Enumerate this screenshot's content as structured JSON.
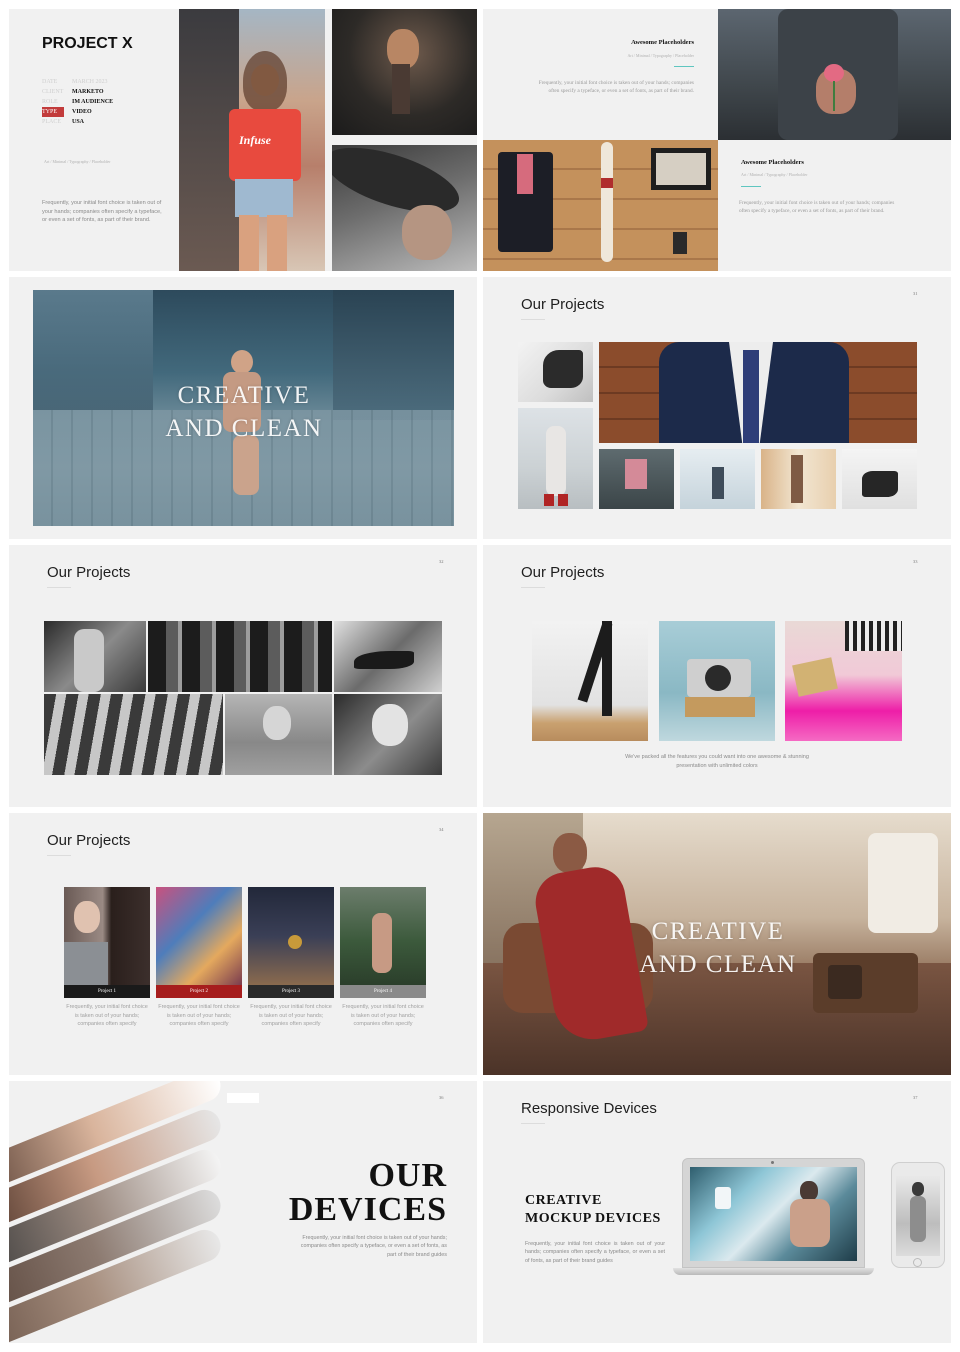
{
  "slide1": {
    "title": "PROJECT X",
    "meta": [
      {
        "key": "DATE",
        "value": "MARCH 2023"
      },
      {
        "key": "CLIENT",
        "value": "MARKETO"
      },
      {
        "key": "ROLE",
        "value": "IM AUDIENCE"
      },
      {
        "key": "TYPE",
        "value": "VIDEO"
      },
      {
        "key": "PLACE",
        "value": "USA"
      }
    ],
    "tags": "Art  /  Minimal  /  Typography  /  Placeholder",
    "body": "Frequently, your initial font choice is taken out of your hands; companies often specify a typeface, or even a set of fonts, as part of their brand.",
    "shirt_text": "Infuse"
  },
  "slide2": {
    "heading_top": "Awesome Placeholders",
    "tags_top": "Art  /  Minimal  /  Typography  /  Placeholder",
    "body_top": "Frequently, your initial font choice is taken out of your hands; companies often specify a typeface, or even a set of fonts, as part of their brand.",
    "heading_bottom": "Awesome Placeholders",
    "tags_bottom": "Art  /  Minimal  /  Typography  /  Placeholder",
    "body_bottom": "Frequently, your initial font choice is taken out of your hands; companies often specify a typeface, or even a set of fonts, as part of their brand."
  },
  "slide3": {
    "line1": "CREATIVE",
    "line2": "AND CLEAN"
  },
  "slide4": {
    "title": "Our Projects",
    "page": "31"
  },
  "slide5": {
    "title": "Our Projects",
    "page": "32"
  },
  "slide6": {
    "title": "Our Projects",
    "page": "33",
    "caption_line1": "We've packed all the features you could want into one awesome & stunning",
    "caption_line2": "presentation with unlimited colors"
  },
  "slide7": {
    "title": "Our Projects",
    "page": "34",
    "projects": [
      {
        "label": "Project 1",
        "bar_color": "#1a1a1a",
        "desc": "Frequently, your initial font choice is taken out of your hands; companies often specify"
      },
      {
        "label": "Project 2",
        "bar_color": "#a61d1d",
        "desc": "Frequently, your initial font choice is taken out of your hands; companies often specify"
      },
      {
        "label": "Project 3",
        "bar_color": "#2a2a2a",
        "desc": "Frequently, your initial font choice is taken out of your hands; companies often specify"
      },
      {
        "label": "Project 4",
        "bar_color": "#8a8a8a",
        "desc": "Frequently, your initial font choice is taken out of your hands; companies often specify"
      }
    ]
  },
  "slide8": {
    "line1": "CREATIVE",
    "line2": "AND CLEAN"
  },
  "slide9": {
    "page": "36",
    "line1": "OUR",
    "line2": "DEVICES",
    "body": "Frequently, your initial font choice is taken out of your hands; companies often specify a typeface, or even a set of fonts, as part of their brand guides"
  },
  "slide10": {
    "title": "Responsive Devices",
    "page": "37",
    "line1": "CREATIVE",
    "line2": "MOCKUP DEVICES",
    "body": "Frequently, your initial font choice is taken out of your hands; companies often specify a typeface, or even a set of fonts, as part of their brand guides"
  },
  "colors": {
    "background": "#f1f1f1",
    "accent_teal": "#5fc6c0",
    "accent_red": "#a61d1d"
  }
}
